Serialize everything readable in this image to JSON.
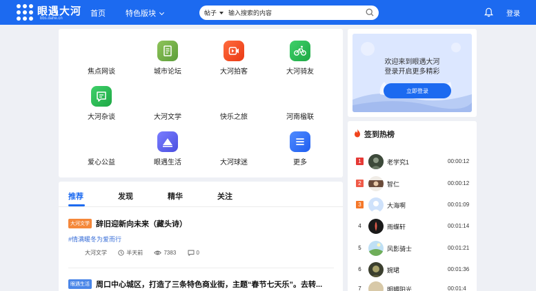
{
  "header": {
    "brand": "眼遇大河",
    "brand_sub": "bbs.dahe.cn",
    "nav_home": "首页",
    "nav_feature": "特色版块",
    "search_type": "帖子",
    "search_placeholder": "输入搜索的内容",
    "login": "登录",
    "accent_color": "#1c6af0"
  },
  "categories": [
    {
      "label": "焦点网谈",
      "icon": "none"
    },
    {
      "label": "城市论坛",
      "icon": "document-icon",
      "color": "#6aa84f"
    },
    {
      "label": "大河拍客",
      "icon": "video-icon",
      "color": "#f04a1c"
    },
    {
      "label": "大河骑友",
      "icon": "bicycle-icon",
      "color": "#2eb84a"
    },
    {
      "label": "大河杂谈",
      "icon": "chat-icon",
      "color": "#2ec25a"
    },
    {
      "label": "大河文学",
      "icon": "none"
    },
    {
      "label": "快乐之旅",
      "icon": "none"
    },
    {
      "label": "河南楹联",
      "icon": "none"
    },
    {
      "label": "爱心公益",
      "icon": "none"
    },
    {
      "label": "眼遇生活",
      "icon": "mountain-icon",
      "color": "#5a5ff0"
    },
    {
      "label": "大河球迷",
      "icon": "none"
    },
    {
      "label": "更多",
      "icon": "list-icon",
      "color": "#2d6ff5"
    }
  ],
  "welcome": {
    "line1": "欢迎来到眼遇大河",
    "line2": "登录开启更多精彩",
    "button": "立即登录"
  },
  "ranking": {
    "title": "签到热榜",
    "items": [
      {
        "rank": "1",
        "name": "老学究1",
        "time": "00:00:12"
      },
      {
        "rank": "2",
        "name": "智仁",
        "time": "00:00:12"
      },
      {
        "rank": "3",
        "name": "大海啊",
        "time": "00:01:09"
      },
      {
        "rank": "4",
        "name": "雨蝶轩",
        "time": "00:01:14"
      },
      {
        "rank": "5",
        "name": "风影骑士",
        "time": "00:01:21"
      },
      {
        "rank": "6",
        "name": "婉珺",
        "time": "00:01:36"
      },
      {
        "rank": "7",
        "name": "明媚阳光",
        "time": "00:01:4"
      }
    ]
  },
  "feed": {
    "tabs": [
      "推荐",
      "发现",
      "精华",
      "关注"
    ],
    "posts": [
      {
        "badge": "大河文学",
        "badge_color": "#f5883a",
        "title": "辞旧迎新向未来（藏头诗）",
        "topic": "#情满暖冬为爱而行",
        "author": "大河文学",
        "time": "半天前",
        "views": "7383",
        "comments": "0"
      },
      {
        "badge": "眼遇生活",
        "badge_color": "#4a86e8",
        "title": "周口中心城区，打造了三条特色商业街，主题“春节七天乐”。去转..."
      }
    ]
  }
}
